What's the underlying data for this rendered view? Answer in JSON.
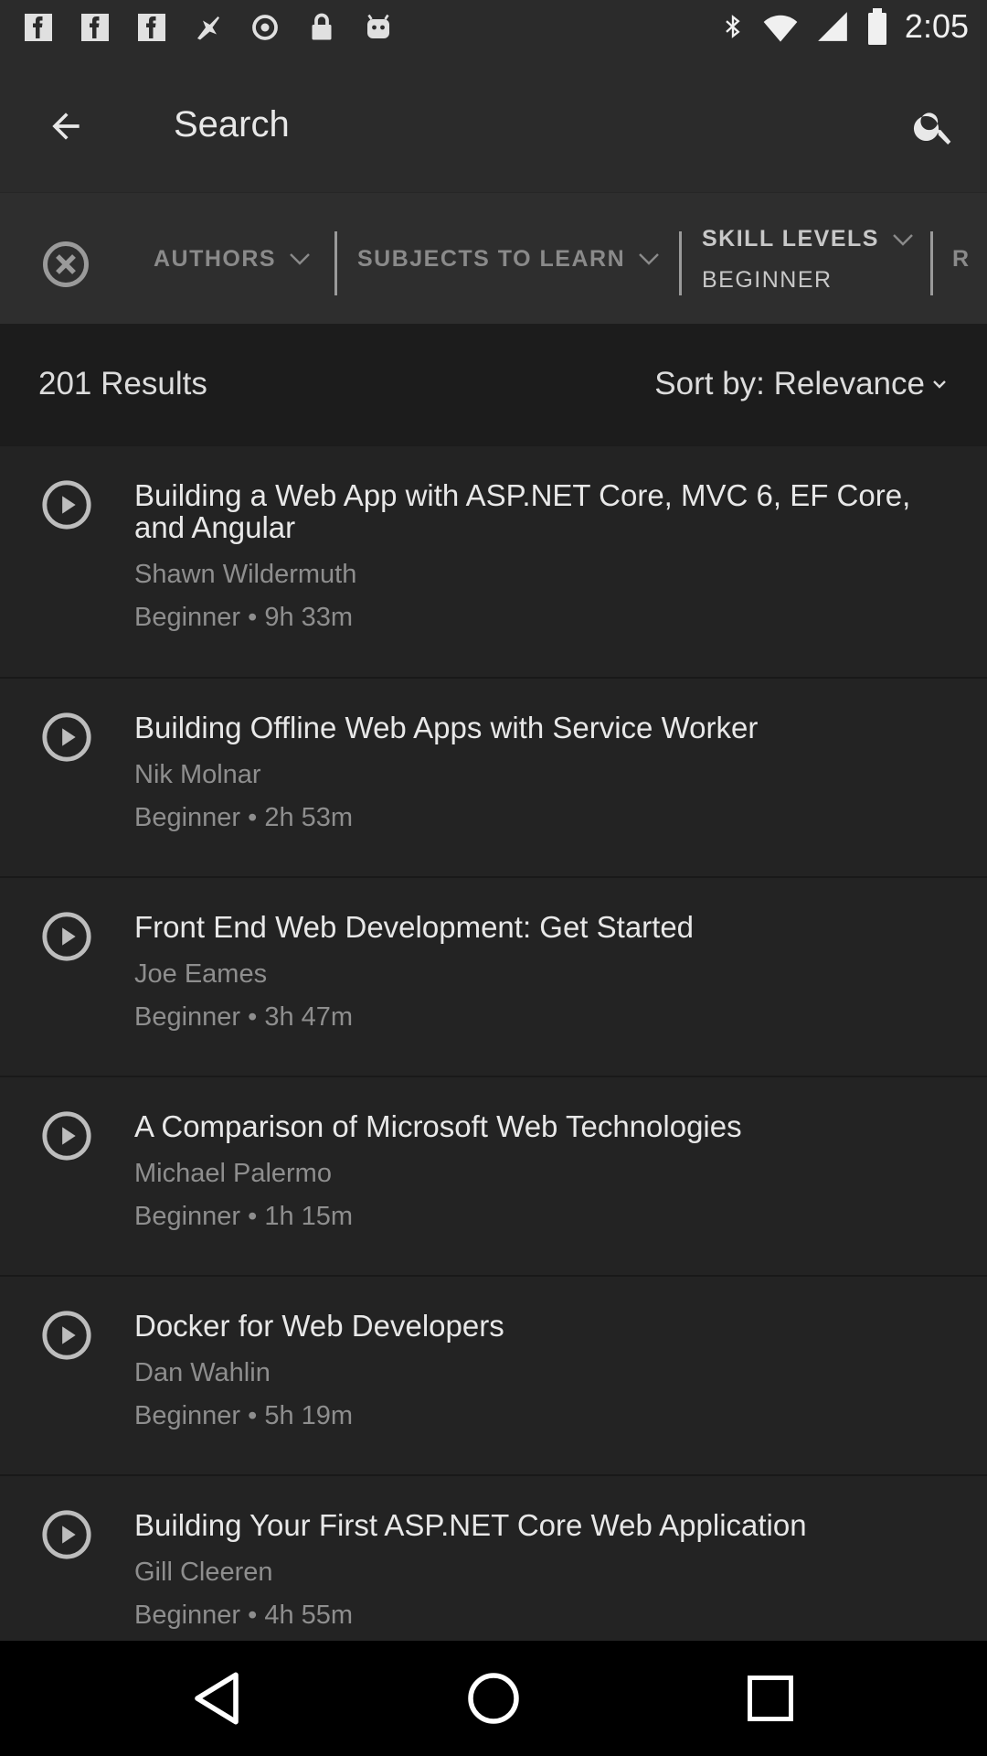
{
  "status_bar": {
    "time": "2:05",
    "left_icons": [
      "f-icon",
      "f-icon",
      "f-icon",
      "fax-icon",
      "cast-icon",
      "lock-icon",
      "android-icon"
    ],
    "right_icons": [
      "bluetooth-icon",
      "wifi-icon",
      "signal-icon",
      "battery-icon"
    ]
  },
  "app_bar": {
    "title": "Search"
  },
  "filters": {
    "authors": "AUTHORS",
    "subjects": "SUBJECTS TO LEARN",
    "skill_levels": "SKILL LEVELS",
    "skill_value": "BEGINNER",
    "next_cut": "R"
  },
  "results": {
    "count": "201 Results",
    "sort_label": "Sort by: Relevance"
  },
  "courses": [
    {
      "title": "Building a Web App with ASP.NET Core, MVC 6, EF Core, and Angular",
      "author": "Shawn Wildermuth",
      "meta": "Beginner • 9h 33m"
    },
    {
      "title": "Building Offline Web Apps with Service Worker",
      "author": "Nik Molnar",
      "meta": "Beginner • 2h 53m"
    },
    {
      "title": "Front End Web Development: Get Started",
      "author": "Joe Eames",
      "meta": "Beginner • 3h 47m"
    },
    {
      "title": "A Comparison of Microsoft Web Technologies",
      "author": "Michael Palermo",
      "meta": "Beginner • 1h 15m"
    },
    {
      "title": "Docker for Web Developers",
      "author": "Dan Wahlin",
      "meta": "Beginner • 5h 19m"
    },
    {
      "title": "Building Your First ASP.NET Core Web Application",
      "author": "Gill Cleeren",
      "meta": "Beginner • 4h 55m"
    }
  ],
  "colors": {
    "background": "#232323",
    "app_bar": "#2b2b2b",
    "results_header": "#1c1c1c",
    "text_primary": "#e8e8e8",
    "text_secondary": "#8e8e8e"
  }
}
